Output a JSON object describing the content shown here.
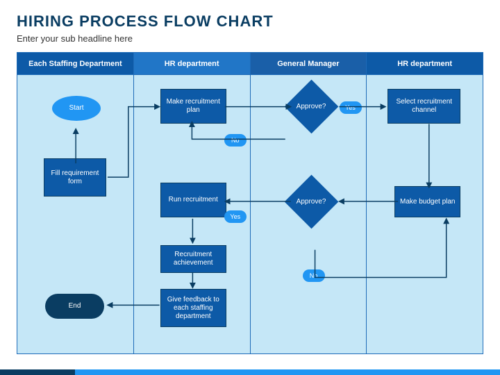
{
  "title": "HIRING PROCESS FLOW CHART",
  "subtitle": "Enter your sub headline here",
  "lanes": [
    "Each Staffing Department",
    "HR department",
    "General Manager",
    "HR department"
  ],
  "nodes": {
    "start": "Start",
    "fill": "Fill requirement form",
    "plan": "Make recruitment plan",
    "run": "Run recruitment",
    "achieve": "Recruitment achievement",
    "feedback": "Give feedback to each staffing department",
    "approve1": "Approve?",
    "approve2": "Approve?",
    "select": "Select recruitment channel",
    "budget": "Make budget plan",
    "end": "End",
    "yes": "Yes",
    "no": "No"
  }
}
